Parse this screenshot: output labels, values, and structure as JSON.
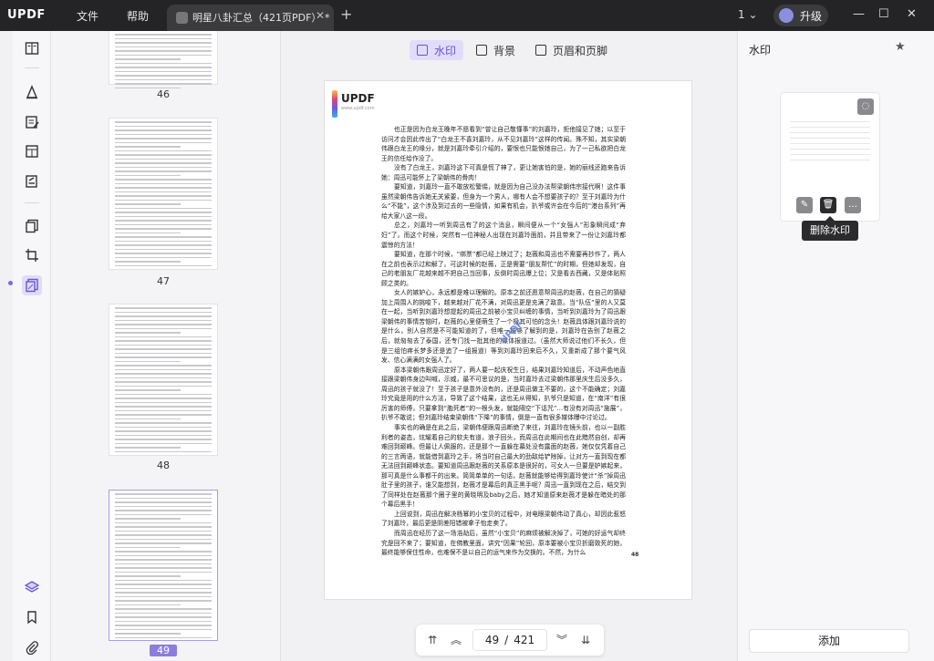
{
  "app": {
    "logo": "UPDF",
    "menu": [
      "文件",
      "帮助"
    ],
    "tab_title": "明星八卦汇总（421页PDF）",
    "tab_modified": "*",
    "new_tab": "+",
    "page_count_selector": "1",
    "upgrade_label": "升级",
    "window_controls": [
      "—",
      "☐",
      "✕"
    ]
  },
  "toolbar": {
    "modes": [
      {
        "label": "水印",
        "active": true
      },
      {
        "label": "背景",
        "active": false
      },
      {
        "label": "页眉和页脚",
        "active": false
      }
    ]
  },
  "thumbnails": [
    {
      "page": "46",
      "selected": false
    },
    {
      "page": "47",
      "selected": false
    },
    {
      "page": "48",
      "selected": false
    },
    {
      "page": "49",
      "selected": true
    }
  ],
  "document": {
    "logo_text": "UPDF",
    "logo_sub": "www.updf.com",
    "watermark_text": "UPDF",
    "page_number": "48",
    "paragraphs": [
      "也正是因为白龙王晚年不愿看到“曾让自己敬懂事”的刘嘉玲，拒他接见了她；以至于访问才会因此传出了“白龙王不喜刘嘉玲，从不见刘嘉玲”这样的传闻。殊不知，其实梁朝伟跟白龙王的缘分，就是刘嘉玲牵引介绍的，要恨也只能恨她自己，为了一己私欲把白龙王的信任给作没了。",
      "没有了白龙王，刘嘉玲这下可真是慌了神了，更让她害怕的是，她的丽线还跑来告诉她：周迅可能怀上了梁朝伟的骨肉！",
      "要知道，刘嘉玲一直不敢放松警惕，就是因为自己没办法帮梁朝伟宗接代啊！这件事虽然梁朝伟告诉她无关紧要，但身为一个男人，哪有人会不想要孩子的？至于刘嘉玲为什么“不能”，这个涉及到过去的一些隐情，如果有机会，扒爷或许会在今后的“港台系列”再给大家八这一段。",
      "总之，刘嘉玲一听到周迅有了的这个消息，瞬间便从一个“女强人”形象瞬间成“弃妇”了。而这个时候，突然有一位神秘人出现在刘嘉玲面前，并且带来了一份让刘嘉玲都震惊的方法！",
      "要知道，在那个时候，“绑票”都已经上映过了；赵薇和周迅也不需要再抄作了，两人在之前也表示过和解了。可这时候的赵薇，正是需要“朋友帮忙”的时期，但她却发现，自己的老朋友厂花越来越不把自己当回事，反倒时周迅爆上位；又是看去西藏，又是体贴照顾之类的。",
      "女人的嫉妒心，永远都是难以理解的。原本之前还愿意帮周迅的赵薇，在自己的猜疑加上周围人的挑唆下，越来越对厂花不满，对周迅更是充满了敌意。当“队伍”里的人又莫在一起，当听到刘嘉玲想提起的周迅之前被小宝贝纠缠的事情，当听到刘嘉玲为了周迅跟梁朝伟的事情苦恼时，赵薇的心里便萌生了一个极其可怕的念头！赵薇具体跟刘嘉玲说的是什么，别人自然是不可能知道的了，但唯一能够了解到的是，刘嘉玲在告别了赵薇之后，就匆匆去了泰国，还专门找一批其他的媒体报道过。（虽然大师说过他们不长久，但是三组怕疼长梦多还是追了一组报道）等到刘嘉玲回来后不久，又重新成了那个要气风发、信心满满的女强人了。",
      "原本梁朝伟跟周迅定好了，两人要一起庆祝生日，结果刘嘉玲知道后，不动声色地直接跟梁朝伟身边叫喊，示威，最不可思议的是，当时嘉玲去过梁朝伟那里庆生后没多久，周迅的孩子就没了！至于孩子是意外没有的，还是周迅做主不要的，这个不能确定；刘嘉玲究竟是用的什么方法，导致了这个结果，这也无从得知，扒爷只是知道，在“南洋”有很厉害的师傅，只要拿到“胞死者”的一根头发，就能隔空“下话咒”…有没有对周迅“施展”，扒爷不敢说；但刘嘉玲结束梁朝伟“下降”的事情，倒是一直有很多媒体曝中讨论过。",
      "事实也的确是在此之后，梁朝伟便跟周迅断绝了来往，刘嘉玲在镜头前，也以一副胜利者的姿态，炫耀着自己的软夫有道，浪子回头，而周迅在此期间也在此黯然自创，却再难回到巅峰。但最让人佩服的，还是那个一直躲在幕处没有露面的赵薇，她仅仅凭着自己的三言两语，就能借到嘉玲之手，将当时自己最大的劲敌给铲除掉，让对方一直到现在都无法回到巅峰状态。要知道周迅跟赵薇的关系原本是很好的，可女人一旦要是妒嫉起来，那可真是什么事都干的出来。简简单单的一句话，赵薇就能够给得到嘉玲使计“杀”掉周迅肚子里的孩子，谁又能想到，赵薇才是幕后的真正黑手呢？周迅一直到现在之后，结交到了同样处在赵薇那个圈子里的黄晓明及baby之后，她才知道原来赵薇才是躲在暗处的那个幕后黑手！",
      "上回说到，周迅在解决杨幂的小宝贝的过程中，对电眼梁朝伟动了真心，却因此惹怒了刘嘉玲，最后更是阴差阳错被拿子怡走卖了。",
      "而周迅在经历了这一场浩劫后，虽然“小宝贝”的麻烦被解决掉了，可她的好运气却终究是回不来了；要知道，在佛教里面，讲究“因果”轮回，原本要被小宝贝折磨致死的她，最终能够保住性命，也难保不是以自己的运气来作为交换的。不然，为什么"
    ]
  },
  "pager": {
    "current": "49",
    "separator": "/",
    "total": "421"
  },
  "right_panel": {
    "title": "水印",
    "tooltip": "删除水印",
    "add_button": "添加"
  },
  "colors": {
    "accent": "#7a6ad8",
    "titlebar": "#242426",
    "panel": "#f7f7f9"
  }
}
